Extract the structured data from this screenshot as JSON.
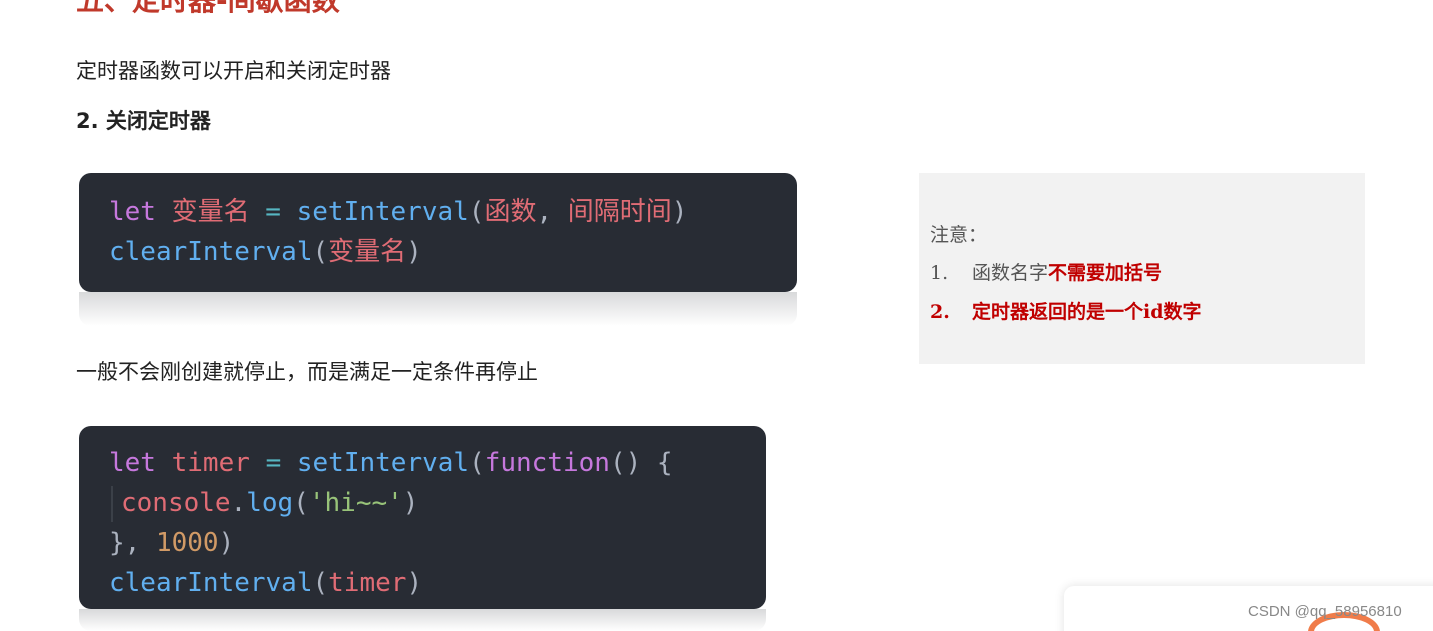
{
  "section_heading": "五、定时器-间歇函数",
  "intro_text": "定时器函数可以开启和关闭定时器",
  "subheading": "2. 关闭定时器",
  "code1": {
    "line1": {
      "kw": "let",
      "var": "变量名",
      "op": "=",
      "fn": "setInterval",
      "open": "(",
      "arg1": "函数",
      "comma": ",",
      "arg2": "间隔时间",
      "close": ")"
    },
    "line2": {
      "fn": "clearInterval",
      "open": "(",
      "arg": "变量名",
      "close": ")"
    }
  },
  "middle_text": "一般不会刚创建就停止，而是满足一定条件再停止",
  "code2": {
    "line1": {
      "kw": "let",
      "var": "timer",
      "op": "=",
      "fn": "setInterval",
      "open": "(",
      "kw2": "function",
      "parens": "()",
      "brace": "{"
    },
    "line2": {
      "obj": "console",
      "dot": ".",
      "fn": "log",
      "open": "(",
      "str": "'hi~~'",
      "close": ")"
    },
    "line3": {
      "brace": "},",
      "num": "1000",
      "close": ")"
    },
    "line4": {
      "fn": "clearInterval",
      "open": "(",
      "arg": "timer",
      "close": ")"
    }
  },
  "note": {
    "title": "注意：",
    "items": [
      {
        "num": "1.",
        "plain": "函数名字",
        "emph": "不需要加括号"
      },
      {
        "num": "2.",
        "text": "定时器返回的是一个id数字"
      }
    ]
  },
  "watermark": "CSDN @qq_58956810",
  "colors": {
    "heading": "#c0392b",
    "code_bg": "#282c34",
    "keyword": "#c678dd",
    "variable": "#e06c75",
    "function": "#61afef",
    "string": "#98c379",
    "number": "#d19a66",
    "note_emphasis": "#c00000"
  }
}
